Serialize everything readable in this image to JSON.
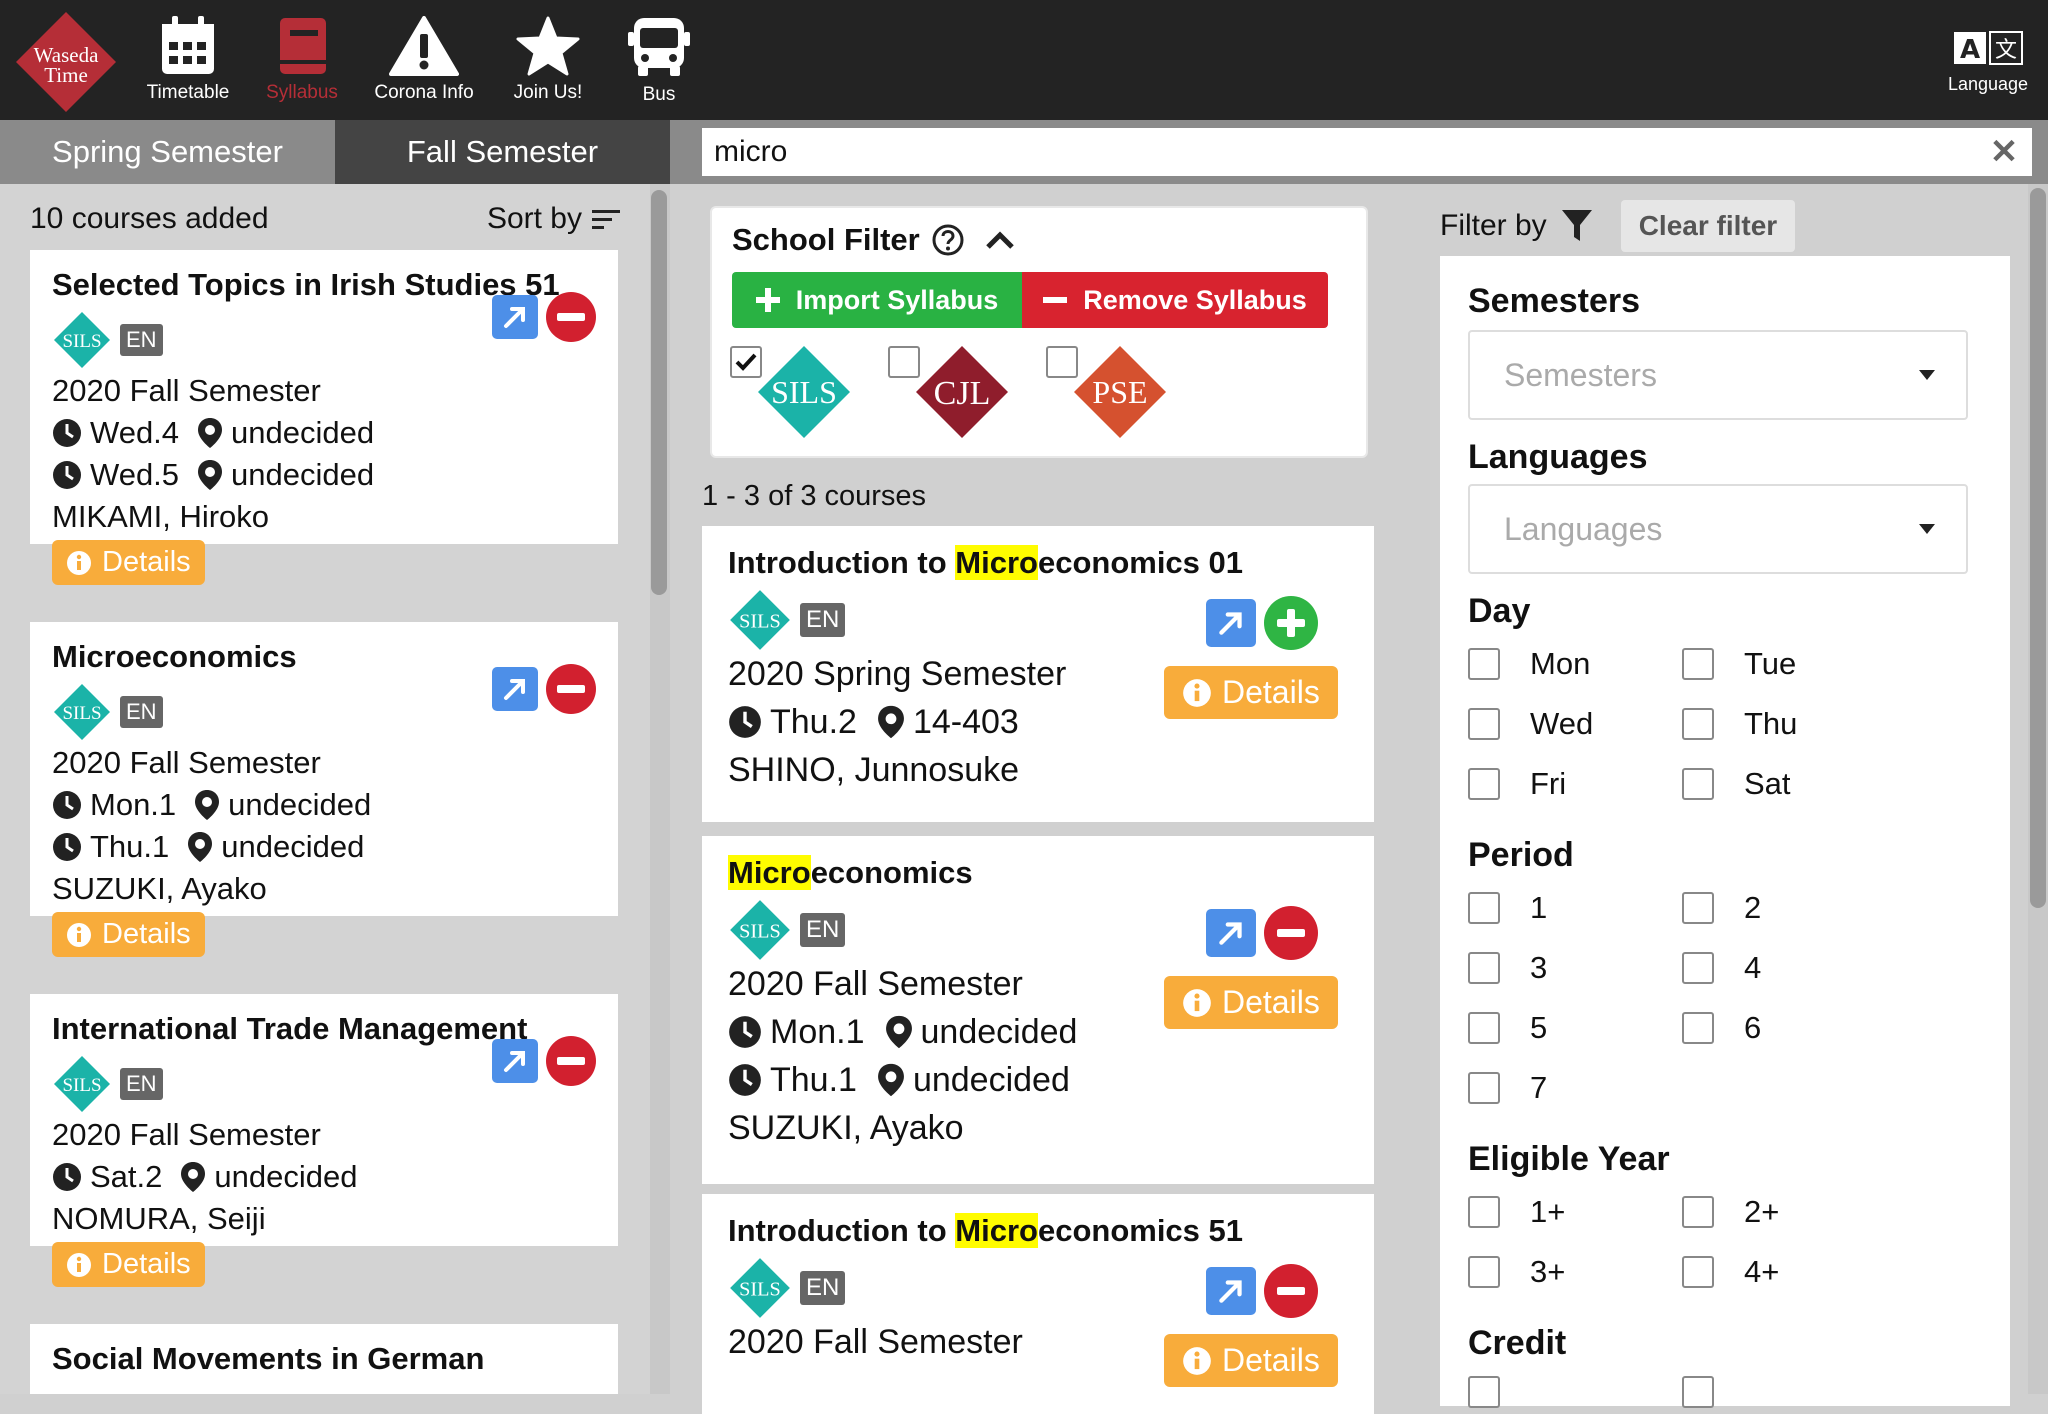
{
  "brand": {
    "line1": "Waseda",
    "line2": "Time",
    "color": "#b52e37"
  },
  "nav": {
    "timetable": "Timetable",
    "syllabus": "Syllabus",
    "corona": "Corona Info",
    "join": "Join Us!",
    "bus": "Bus",
    "language": "Language"
  },
  "semester_tabs": {
    "spring": "Spring Semester",
    "fall": "Fall Semester",
    "active": "fall"
  },
  "added": {
    "count_text": "10 courses added",
    "sort_label": "Sort by",
    "courses": [
      {
        "title": "Selected Topics in Irish Studies 51",
        "school": "SILS",
        "lang": "EN",
        "semester": "2020 Fall Semester",
        "slots": [
          {
            "time": "Wed.4",
            "location": "undecided"
          },
          {
            "time": "Wed.5",
            "location": "undecided"
          }
        ],
        "instructor": "MIKAMI, Hiroko",
        "details": "Details"
      },
      {
        "title": "Microeconomics",
        "school": "SILS",
        "lang": "EN",
        "semester": "2020 Fall Semester",
        "slots": [
          {
            "time": "Mon.1",
            "location": "undecided"
          },
          {
            "time": "Thu.1",
            "location": "undecided"
          }
        ],
        "instructor": "SUZUKI, Ayako",
        "details": "Details"
      },
      {
        "title": "International Trade Management",
        "school": "SILS",
        "lang": "EN",
        "semester": "2020 Fall Semester",
        "slots": [
          {
            "time": "Sat.2",
            "location": "undecided"
          }
        ],
        "instructor": "NOMURA, Seiji",
        "details": "Details"
      },
      {
        "title": "Social Movements in German"
      }
    ]
  },
  "search": {
    "value": "micro",
    "clear": "✕"
  },
  "school_filter": {
    "title": "School Filter",
    "import": "Import Syllabus",
    "remove": "Remove Syllabus",
    "schools": [
      {
        "name": "SILS",
        "checked": true,
        "color": "#1bb3a8"
      },
      {
        "name": "CJL",
        "checked": false,
        "color": "#8f1d2c"
      },
      {
        "name": "PSE",
        "checked": false,
        "color": "#d5512f"
      }
    ]
  },
  "results": {
    "count_text": "1 - 3 of 3 courses",
    "courses": [
      {
        "title_pre": "Introduction to ",
        "title_hl": "Micro",
        "title_post": "economics 01",
        "school": "SILS",
        "lang": "EN",
        "semester": "2020 Spring Semester",
        "slots": [
          {
            "time": "Thu.2",
            "location": "14-403"
          }
        ],
        "instructor": "SHINO, Junnosuke",
        "details": "Details",
        "action": "add"
      },
      {
        "title_pre": "",
        "title_hl": "Micro",
        "title_post": "economics",
        "school": "SILS",
        "lang": "EN",
        "semester": "2020 Fall Semester",
        "slots": [
          {
            "time": "Mon.1",
            "location": "undecided"
          },
          {
            "time": "Thu.1",
            "location": "undecided"
          }
        ],
        "instructor": "SUZUKI, Ayako",
        "details": "Details",
        "action": "remove"
      },
      {
        "title_pre": "Introduction to ",
        "title_hl": "Micro",
        "title_post": "economics 51",
        "school": "SILS",
        "lang": "EN",
        "semester": "2020 Fall Semester",
        "details": "Details",
        "action": "remove"
      }
    ]
  },
  "filter": {
    "title": "Filter by",
    "clear": "Clear filter",
    "semesters_label": "Semesters",
    "semesters_placeholder": "Semesters",
    "languages_label": "Languages",
    "languages_placeholder": "Languages",
    "day_label": "Day",
    "days": [
      "Mon",
      "Tue",
      "Wed",
      "Thu",
      "Fri",
      "Sat"
    ],
    "period_label": "Period",
    "periods": [
      "1",
      "2",
      "3",
      "4",
      "5",
      "6",
      "7"
    ],
    "year_label": "Eligible Year",
    "years": [
      "1+",
      "2+",
      "3+",
      "4+"
    ],
    "credit_label": "Credit"
  }
}
